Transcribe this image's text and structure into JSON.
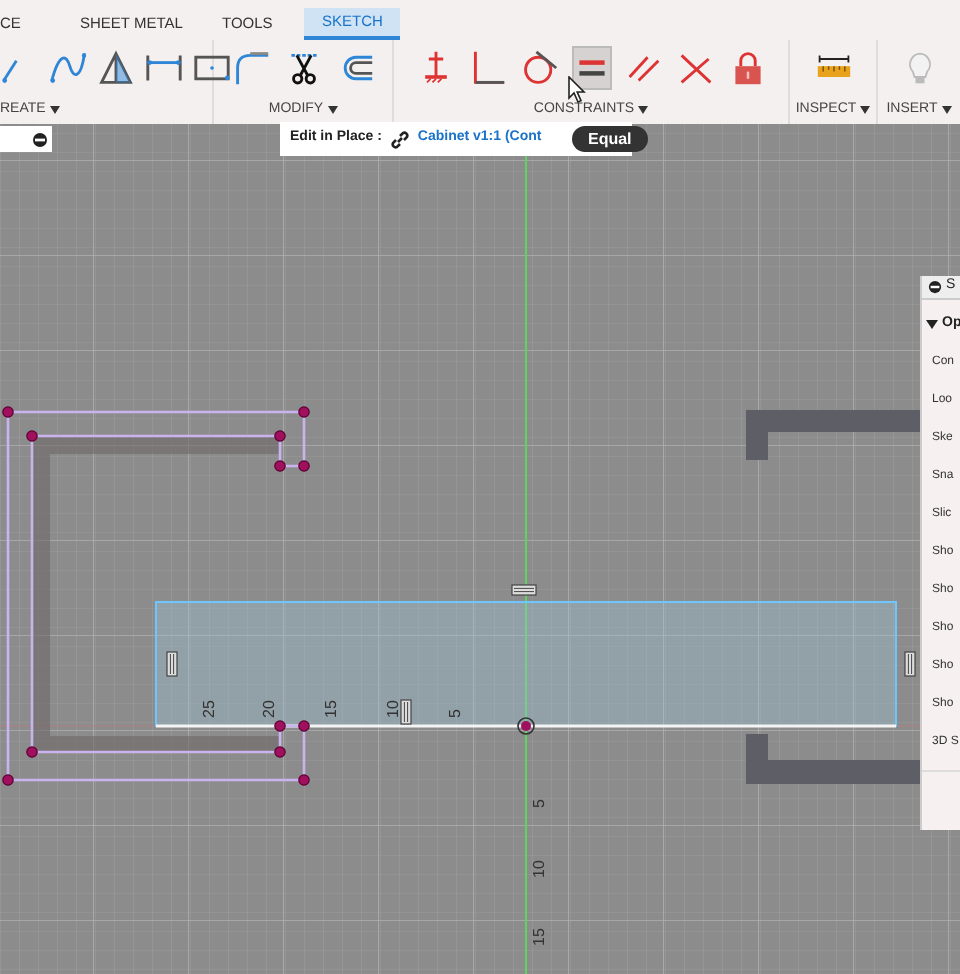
{
  "tabs": [
    {
      "label": "CE",
      "selected": false
    },
    {
      "label": "SHEET METAL",
      "selected": false
    },
    {
      "label": "TOOLS",
      "selected": false
    },
    {
      "label": "SKETCH",
      "selected": true
    }
  ],
  "groups": [
    {
      "label": "REATE",
      "tools": [
        {
          "selected": false
        },
        {
          "selected": false
        },
        {
          "selected": false
        },
        {
          "selected": false
        },
        {
          "selected": false
        }
      ]
    },
    {
      "label": "MODIFY",
      "tools": [
        {
          "selected": false
        },
        {
          "selected": false
        },
        {
          "selected": false
        }
      ]
    },
    {
      "label": "CONSTRAINTS",
      "tools": [
        {
          "selected": false
        },
        {
          "selected": false
        },
        {
          "selected": false
        },
        {
          "selected": true
        },
        {
          "selected": false
        },
        {
          "selected": false
        },
        {
          "selected": false
        }
      ]
    },
    {
      "label": "INSPECT",
      "tools": [
        {
          "selected": false
        }
      ]
    },
    {
      "label": "INSERT",
      "tools": [
        {
          "selected": false
        }
      ]
    }
  ],
  "edit_bar": {
    "label": "Edit in Place :",
    "component": "Cabinet v1:1 (Cont"
  },
  "tooltip": {
    "text": "Equal"
  },
  "sketch_palette": {
    "title": "S",
    "section": {
      "label": "Op",
      "expanded": true
    },
    "items": [
      "Con",
      "Loo",
      "Ske",
      "Sna",
      "Slic",
      "Sho",
      "Sho",
      "Sho",
      "Sho",
      "Sho",
      "3D S"
    ]
  },
  "axis_labels": {
    "horizontal": [
      "25",
      "20",
      "15",
      "10",
      "5"
    ],
    "vertical": [
      "5",
      "10",
      "15"
    ]
  }
}
